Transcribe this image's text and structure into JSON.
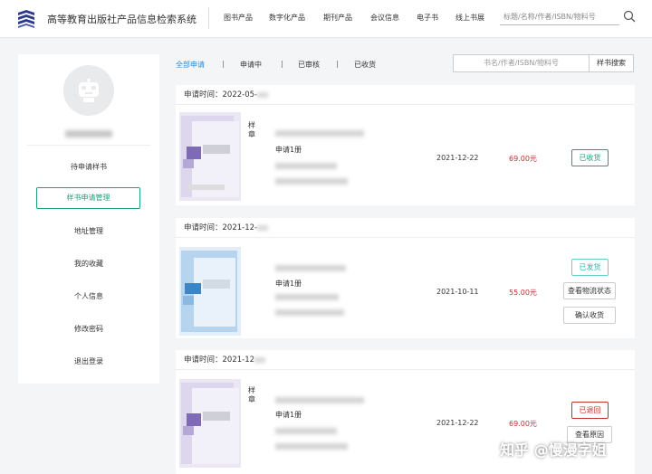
{
  "header": {
    "site_title": "高等教育出版社产品信息检索系统",
    "nav": [
      "图书产品",
      "数字化产品",
      "期刊产品",
      "会议信息",
      "电子书",
      "线上书展"
    ],
    "search_placeholder": "标题/名称/作者/ISBN/物料号",
    "brand_color": "#2b3a8c"
  },
  "sidebar": {
    "items": [
      {
        "label": "待申请样书",
        "active": false
      },
      {
        "label": "样书申请管理",
        "active": true
      },
      {
        "label": "地址管理",
        "active": false
      },
      {
        "label": "我的收藏",
        "active": false
      },
      {
        "label": "个人信息",
        "active": false
      },
      {
        "label": "修改密码",
        "active": false
      },
      {
        "label": "退出登录",
        "active": false
      }
    ],
    "accent_color": "#1ea37a"
  },
  "tabs": {
    "items": [
      "全部申请",
      "申请中",
      "已审核",
      "已收货"
    ],
    "separator": "|",
    "active_color": "#2d8bd6"
  },
  "main_search": {
    "placeholder": "书名/作者/ISBN/物料号",
    "button": "样书搜索"
  },
  "orders": [
    {
      "applied_label": "申请时间：",
      "applied_time": "2022-05-",
      "sample_tag": "样章",
      "quantity": "申请1册",
      "date": "2021-12-22",
      "price": "69.00元",
      "status": "已收货",
      "status_color": "#1ea37a",
      "actions": []
    },
    {
      "applied_label": "申请时间：",
      "applied_time": "2021-12-",
      "sample_tag": "",
      "quantity": "申请1册",
      "date": "2021-10-11",
      "price": "55.00元",
      "status": "已发货",
      "status_color": "#2db7b0",
      "actions": [
        "查看物流状态",
        "确认收货"
      ]
    },
    {
      "applied_label": "申请时间：",
      "applied_time": "2021-12",
      "sample_tag": "样章",
      "quantity": "申请1册",
      "date": "2021-12-22",
      "price": "69.00元",
      "status": "已退回",
      "status_color": "#c03232",
      "actions": [
        "查看原因"
      ]
    }
  ],
  "watermark": "知乎 @慢漫字姐",
  "price_color": "#c03232"
}
